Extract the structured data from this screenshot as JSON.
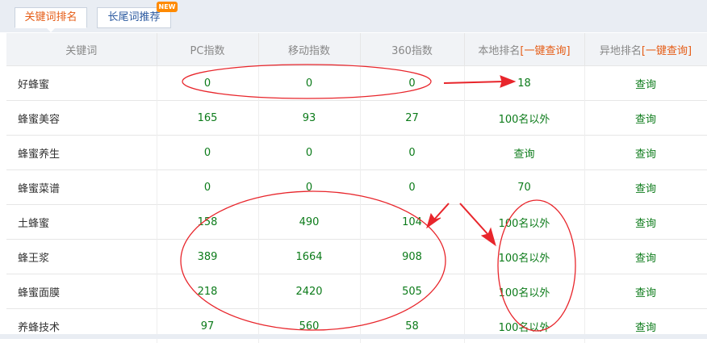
{
  "tabs": [
    {
      "label": "关键词排名",
      "active": true
    },
    {
      "label": "长尾词推荐",
      "active": false
    }
  ],
  "new_badge": "NEW",
  "columns": {
    "keyword": "关键词",
    "pc": "PC指数",
    "mobile": "移动指数",
    "s360": "360指数",
    "local": "本地排名",
    "local_link": "[一键查询]",
    "remote": "异地排名",
    "remote_link": "[一键查询]"
  },
  "rows": [
    {
      "keyword": "好蜂蜜",
      "pc": "0",
      "mobile": "0",
      "s360": "0",
      "local": "18",
      "remote": "查询"
    },
    {
      "keyword": "蜂蜜美容",
      "pc": "165",
      "mobile": "93",
      "s360": "27",
      "local": "100名以外",
      "remote": "查询"
    },
    {
      "keyword": "蜂蜜养生",
      "pc": "0",
      "mobile": "0",
      "s360": "0",
      "local": "查询",
      "remote": "查询"
    },
    {
      "keyword": "蜂蜜菜谱",
      "pc": "0",
      "mobile": "0",
      "s360": "0",
      "local": "70",
      "remote": "查询"
    },
    {
      "keyword": "土蜂蜜",
      "pc": "158",
      "mobile": "490",
      "s360": "104",
      "local": "100名以外",
      "remote": "查询"
    },
    {
      "keyword": "蜂王浆",
      "pc": "389",
      "mobile": "1664",
      "s360": "908",
      "local": "100名以外",
      "remote": "查询"
    },
    {
      "keyword": "蜂蜜面膜",
      "pc": "218",
      "mobile": "2420",
      "s360": "505",
      "local": "100名以外",
      "remote": "查询"
    },
    {
      "keyword": "养蜂技术",
      "pc": "97",
      "mobile": "560",
      "s360": "58",
      "local": "100名以外",
      "remote": "查询"
    }
  ],
  "colors": {
    "accent": "#e55c15",
    "value_green": "#0c7b1a",
    "annotation_red": "#e8252b"
  }
}
